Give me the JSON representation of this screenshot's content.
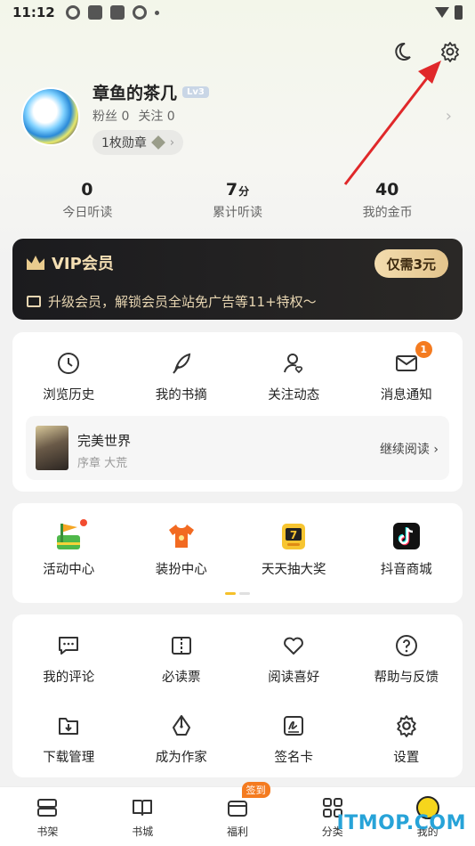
{
  "status_bar": {
    "time": "11:12"
  },
  "profile": {
    "name": "章鱼的茶几",
    "level": "Lv3",
    "fans": "粉丝 0",
    "following": "关注 0",
    "medal": "1枚勋章"
  },
  "stats": [
    {
      "value": "0",
      "unit": "",
      "label": "今日听读"
    },
    {
      "value": "7",
      "unit": "分",
      "label": "累计听读"
    },
    {
      "value": "40",
      "unit": "",
      "label": "我的金币"
    }
  ],
  "vip": {
    "title": "VIP会员",
    "button": "仅需3元",
    "subtitle": "升级会员，解锁会员全站免广告等11+特权～"
  },
  "quick_actions": [
    {
      "label": "浏览历史",
      "icon": "clock-icon"
    },
    {
      "label": "我的书摘",
      "icon": "feather-icon"
    },
    {
      "label": "关注动态",
      "icon": "user-heart-icon"
    },
    {
      "label": "消息通知",
      "icon": "mail-icon",
      "badge": "1"
    }
  ],
  "recent_book": {
    "title": "完美世界",
    "chapter": "序章 大荒",
    "action": "继续阅读 ›"
  },
  "activities": [
    {
      "label": "活动中心",
      "icon": "flag-icon"
    },
    {
      "label": "装扮中心",
      "icon": "shirt-icon"
    },
    {
      "label": "天天抽大奖",
      "icon": "slot-machine-icon"
    },
    {
      "label": "抖音商城",
      "icon": "douyin-bag-icon"
    }
  ],
  "tools": [
    {
      "label": "我的评论",
      "icon": "comment-icon"
    },
    {
      "label": "必读票",
      "icon": "ticket-icon"
    },
    {
      "label": "阅读喜好",
      "icon": "heart-icon"
    },
    {
      "label": "帮助与反馈",
      "icon": "help-icon"
    },
    {
      "label": "下载管理",
      "icon": "download-icon"
    },
    {
      "label": "成为作家",
      "icon": "pen-nib-icon"
    },
    {
      "label": "签名卡",
      "icon": "signature-icon"
    },
    {
      "label": "设置",
      "icon": "gear-icon"
    }
  ],
  "tabbar": [
    {
      "label": "书架",
      "icon": "bookshelf-icon"
    },
    {
      "label": "书城",
      "icon": "book-icon"
    },
    {
      "label": "福利",
      "icon": "gift-icon",
      "tag": "签到"
    },
    {
      "label": "分类",
      "icon": "grid-icon"
    },
    {
      "label": "我的",
      "icon": "smile-icon"
    }
  ],
  "watermark": "ITMOP.COM",
  "colors": {
    "accent": "#f47b20",
    "annotation_arrow": "#e0282a",
    "vip_gold": "#f4dfb4"
  }
}
